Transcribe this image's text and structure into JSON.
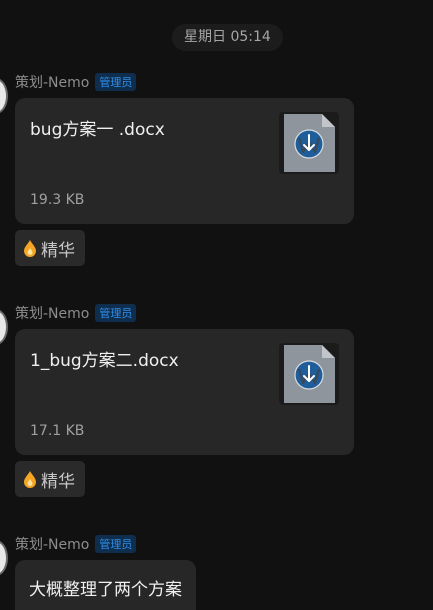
{
  "time_divider": "星期日 05:14",
  "messages": [
    {
      "sender": "策划-Nemo",
      "role": "管理员",
      "type": "file",
      "file_name": "bug方案一 .docx",
      "file_size": "19.3 KB",
      "file_icon": "word-document-download-icon",
      "tag": {
        "icon": "flame-icon",
        "label": "精华"
      }
    },
    {
      "sender": "策划-Nemo",
      "role": "管理员",
      "type": "file",
      "file_name": "1_bug方案二.docx",
      "file_size": "17.1 KB",
      "file_icon": "word-document-download-icon",
      "tag": {
        "icon": "flame-icon",
        "label": "精华"
      }
    },
    {
      "sender": "策划-Nemo",
      "role": "管理员",
      "type": "text",
      "text": "大概整理了两个方案"
    }
  ],
  "colors": {
    "background": "#111111",
    "bubble": "#272727",
    "badge_text": "#2f8eea",
    "badge_bg": "#0f2d4c",
    "tag_icon": "#f5a623"
  }
}
